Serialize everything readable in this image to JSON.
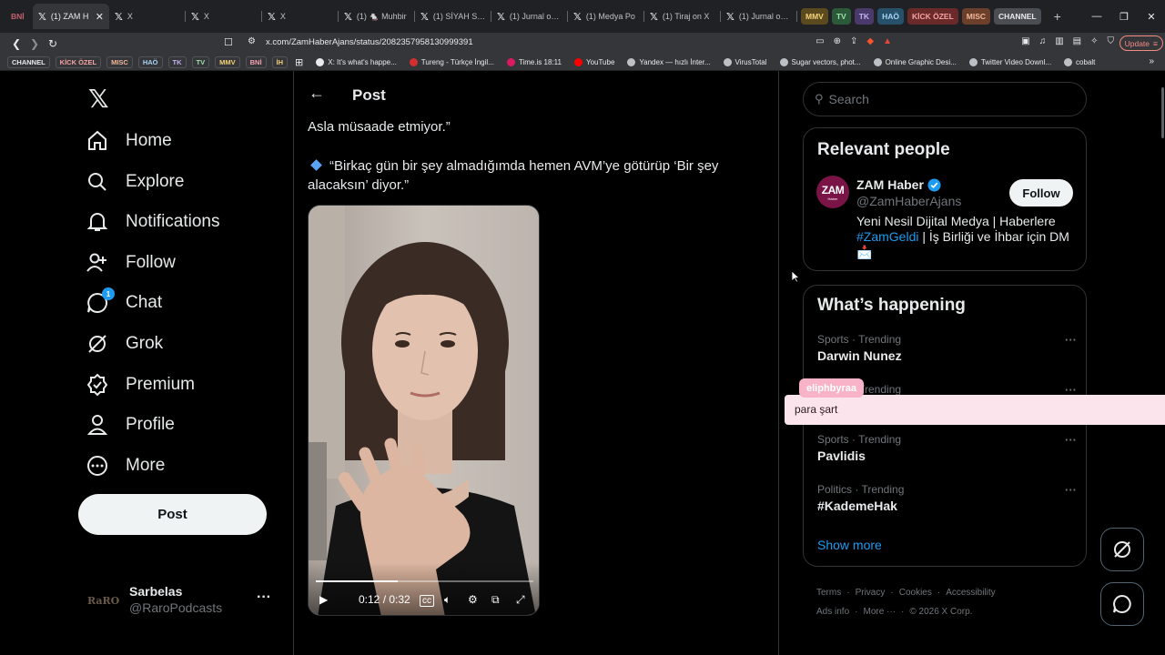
{
  "browser": {
    "tabs": [
      {
        "title": "BNİ",
        "kind": "chip",
        "color": "#c5616f"
      },
      {
        "title": "(1) ZAM H",
        "kind": "x",
        "active": true
      },
      {
        "title": "X",
        "kind": "x"
      },
      {
        "title": "X",
        "kind": "x"
      },
      {
        "title": "X",
        "kind": "x"
      },
      {
        "title": "(1) 🐁 Muhbir",
        "kind": "x"
      },
      {
        "title": "(1) SİYAH SAN",
        "kind": "x"
      },
      {
        "title": "(1) Jurnal on X",
        "kind": "x"
      },
      {
        "title": "(1) Medya Po",
        "kind": "x"
      },
      {
        "title": "(1) Tiraj on X",
        "kind": "x"
      },
      {
        "title": "(1) Jurnal on X",
        "kind": "x"
      }
    ],
    "tab_groups": [
      {
        "label": "MMV",
        "bg": "#5c4a1f",
        "fg": "#f3d37a"
      },
      {
        "label": "TV",
        "bg": "#2b5a3a",
        "fg": "#9ee2a7"
      },
      {
        "label": "TK",
        "bg": "#4a3a6b",
        "fg": "#c5b1f2"
      },
      {
        "label": "HAÖ",
        "bg": "#27506b",
        "fg": "#a8d4f5"
      },
      {
        "label": "KİCK ÖZEL",
        "bg": "#6b2a2a",
        "fg": "#f5a3a3"
      },
      {
        "label": "MISC",
        "bg": "#6b3f2a",
        "fg": "#f2b89a"
      },
      {
        "label": "CHANNEL",
        "bg": "#4a4d52",
        "fg": "#e8eaed"
      }
    ],
    "url": "x.com/ZamHaberAjans/status/2082357958130999391",
    "update_label": "Update",
    "bookmark_chips": [
      {
        "label": "CHANNEL",
        "fg": "#e8eaed"
      },
      {
        "label": "KİCK ÖZEL",
        "fg": "#f5a3a3"
      },
      {
        "label": "MISC",
        "fg": "#f2b89a"
      },
      {
        "label": "HAÖ",
        "fg": "#a8d4f5"
      },
      {
        "label": "TK",
        "fg": "#c5b1f2"
      },
      {
        "label": "TV",
        "fg": "#9ee2a7"
      },
      {
        "label": "MMV",
        "fg": "#f3d37a"
      },
      {
        "label": "BNİ",
        "fg": "#f5a3b4"
      },
      {
        "label": "İH",
        "fg": "#f3d37a"
      }
    ],
    "bookmarks": [
      {
        "label": "X: It's what's happe...",
        "color": "#e8eaed"
      },
      {
        "label": "Tureng - Türkçe İngil...",
        "color": "#d32f2f"
      },
      {
        "label": "Time.is 18:11",
        "color": "#d81b60"
      },
      {
        "label": "YouTube",
        "color": "#ff0000"
      },
      {
        "label": "Yandex — hızlı İnter...",
        "color": "#bdc1c6"
      },
      {
        "label": "VirusTotal",
        "color": "#bdc1c6"
      },
      {
        "label": "Sugar vectors, phot...",
        "color": "#bdc1c6"
      },
      {
        "label": "Online Graphic Desi...",
        "color": "#bdc1c6"
      },
      {
        "label": "Twitter Video Downl...",
        "color": "#bdc1c6"
      },
      {
        "label": "cobalt",
        "color": "#bdc1c6"
      }
    ]
  },
  "nav": {
    "items": [
      {
        "label": "Home",
        "icon": "home-icon"
      },
      {
        "label": "Explore",
        "icon": "search-icon"
      },
      {
        "label": "Notifications",
        "icon": "bell-icon"
      },
      {
        "label": "Follow",
        "icon": "follow-icon"
      },
      {
        "label": "Chat",
        "icon": "chat-icon",
        "badge": "1"
      },
      {
        "label": "Grok",
        "icon": "grok-icon"
      },
      {
        "label": "Premium",
        "icon": "premium-icon"
      },
      {
        "label": "Profile",
        "icon": "profile-icon"
      },
      {
        "label": "More",
        "icon": "more-icon"
      }
    ],
    "post_label": "Post",
    "account": {
      "name": "Sarbelas",
      "handle": "@RaroPodcasts",
      "avatar_text": "RaRO"
    }
  },
  "post": {
    "header_title": "Post",
    "lines": [
      "Asla müsaade etmiyor.”",
      "“Birkaç gün bir şey almadığımda hemen AVM’ye götürüp ‘Bir şey",
      "alacaksın’ diyor.”"
    ],
    "video": {
      "time": "0:12 / 0:32",
      "progress": 0.375
    }
  },
  "right": {
    "search_placeholder": "Search",
    "relevant": {
      "title": "Relevant people",
      "name": "ZAM Haber",
      "handle": "@ZamHaberAjans",
      "follow_label": "Follow",
      "avatar_text": "ZAM",
      "avatar_sub": "Haber",
      "bio_1": "Yeni Nesil Dijital Medya | Haberlere",
      "bio_tag": "#ZamGeldi",
      "bio_2": " | İş Birliği ve İhbar için DM",
      "bio_emoji": "📩"
    },
    "happening": {
      "title": "What’s happening",
      "trends": [
        {
          "context": "Sports · Trending",
          "title": "Darwin Nunez"
        },
        {
          "context": "Sports · Trending",
          "title": ""
        },
        {
          "context": "Sports · Trending",
          "title": "Pavlidis"
        },
        {
          "context": "Politics · Trending",
          "title": "#KademeHak"
        }
      ],
      "show_more": "Show more"
    },
    "footer_row1": [
      "Terms",
      "Privacy",
      "Cookies",
      "Accessibility"
    ],
    "footer_row2": [
      "Ads info",
      "More ···",
      "© 2026 X Corp."
    ]
  },
  "overlay": {
    "username": "eliphbyraa",
    "caption": "para şart"
  }
}
